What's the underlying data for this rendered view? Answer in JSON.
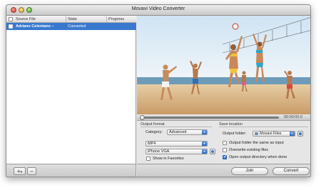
{
  "window": {
    "title": "Movavi Video Converter"
  },
  "file_list": {
    "columns": {
      "source": "Source File",
      "state": "State",
      "progress": "Progress"
    },
    "rows": [
      {
        "source": "Adriano Celentano –",
        "state": "Converted",
        "progress": "",
        "selected": true
      }
    ]
  },
  "left_footer": {
    "add_label": "+",
    "add_menu_label": "▾",
    "remove_label": "–",
    "scroll_left": "◂",
    "scroll_right": "▸"
  },
  "player": {
    "time": "00:00:00.0"
  },
  "output_format": {
    "section_title": "Output format",
    "category_label": "Category:",
    "category_value": "Advanced",
    "format_value": "MP4",
    "preset_value": "iPhone VGA",
    "show_favorites_label": "Show in Favorites",
    "show_favorites_checked": false
  },
  "save_location": {
    "section_title": "Save location",
    "output_folder_label": "Output folder:",
    "output_folder_value": "Movavi Files",
    "same_as_input_label": "Output folder the same as input",
    "same_as_input_checked": false,
    "overwrite_label": "Overwrite existing files",
    "overwrite_checked": false,
    "open_when_done_label": "Open output directory when done",
    "open_when_done_checked": true
  },
  "actions": {
    "join_label": "Join",
    "convert_label": "Convert"
  },
  "colors": {
    "selection": "#3978cf",
    "accent": "#2e68c2"
  }
}
